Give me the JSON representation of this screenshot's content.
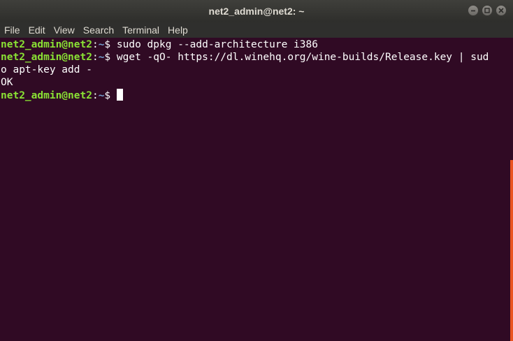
{
  "window": {
    "title": "net2_admin@net2: ~"
  },
  "menu": {
    "items": [
      "File",
      "Edit",
      "View",
      "Search",
      "Terminal",
      "Help"
    ]
  },
  "terminal": {
    "user_host": "net2_admin@net2",
    "sep": ":",
    "path": "~",
    "dollar": "$ ",
    "cmd1": "sudo dpkg --add-architecture i386",
    "cmd2a": "wget -qO- https://dl.winehq.org/wine-builds/Release.key | sud",
    "cmd2b": "o apt-key add -",
    "output1": "OK"
  },
  "colors": {
    "background": "#300a24",
    "prompt_user": "#8ae234",
    "prompt_path": "#729fcf",
    "scrollbar": "#e95420"
  },
  "icons": [
    "minimize-icon",
    "maximize-icon",
    "close-icon"
  ]
}
